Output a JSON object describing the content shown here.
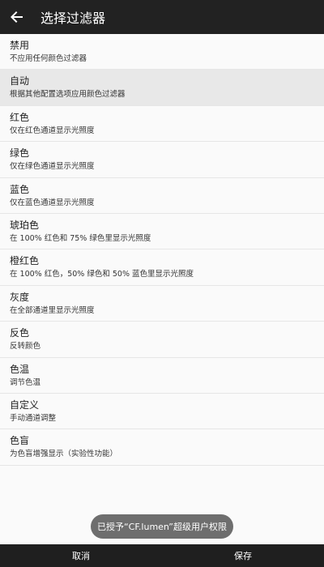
{
  "appbar": {
    "title": "选择过滤器",
    "back_icon": "arrow-left-icon"
  },
  "filters": [
    {
      "title": "禁用",
      "subtitle": "不应用任何颜色过滤器",
      "selected": false
    },
    {
      "title": "自动",
      "subtitle": "根据其他配置选项应用颜色过滤器",
      "selected": true
    },
    {
      "title": "红色",
      "subtitle": "仅在红色通道显示光照度",
      "selected": false
    },
    {
      "title": "绿色",
      "subtitle": "仅在绿色通道显示光照度",
      "selected": false
    },
    {
      "title": "蓝色",
      "subtitle": "仅在蓝色通道显示光照度",
      "selected": false
    },
    {
      "title": "琥珀色",
      "subtitle": "在 100% 红色和 75% 绿色里显示光照度",
      "selected": false
    },
    {
      "title": "橙红色",
      "subtitle": "在 100% 红色，50% 绿色和 50% 蓝色里显示光照度",
      "selected": false
    },
    {
      "title": "灰度",
      "subtitle": "在全部通道里显示光照度",
      "selected": false
    },
    {
      "title": "反色",
      "subtitle": "反转颜色",
      "selected": false
    },
    {
      "title": "色温",
      "subtitle": "调节色温",
      "selected": false
    },
    {
      "title": "自定义",
      "subtitle": "手动通道调整",
      "selected": false
    },
    {
      "title": "色盲",
      "subtitle": "为色盲增强显示（实验性功能）",
      "selected": false
    }
  ],
  "toast": {
    "text": "已授予“CF.lumen”超级用户权限"
  },
  "bottombar": {
    "cancel_label": "取消",
    "save_label": "保存"
  },
  "colors": {
    "appbar": "#222222",
    "selected_row": "#e8e8e8",
    "background": "#fafafa",
    "bottombar": "#1f1f1f",
    "toast": "#6e6e6e"
  }
}
